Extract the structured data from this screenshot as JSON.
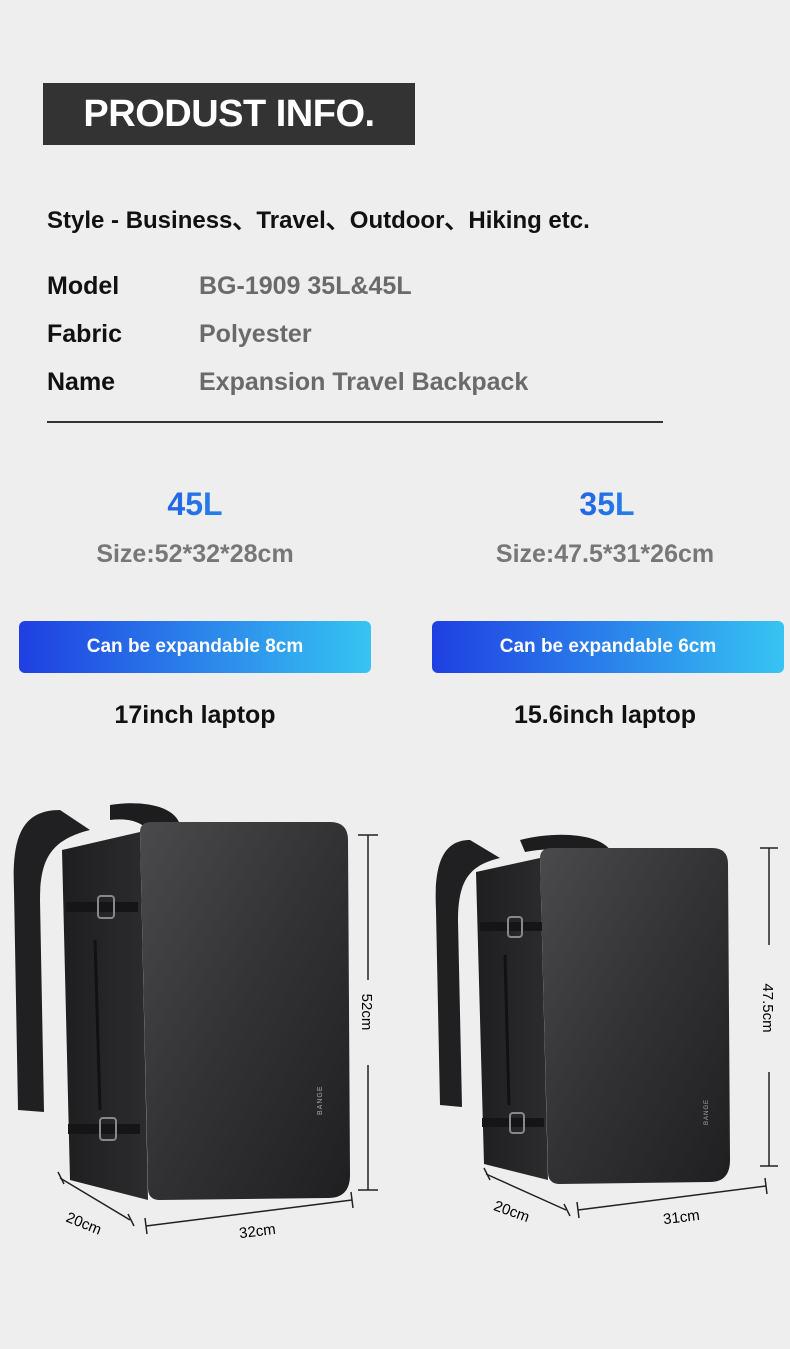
{
  "header": {
    "title": "PRODUST INFO."
  },
  "style_line": "Style - Business、Travel、Outdoor、Hiking etc.",
  "specs": [
    {
      "key": "Model",
      "value": "BG-1909 35L&45L"
    },
    {
      "key": "Fabric",
      "value": "Polyester"
    },
    {
      "key": "Name",
      "value": "Expansion Travel Backpack"
    }
  ],
  "variants": [
    {
      "capacity": "45L",
      "size": "Size:52*32*28cm",
      "expand": "Can be expandable 8cm",
      "laptop": "17inch laptop",
      "dims": {
        "height": "52cm",
        "depth": "20cm",
        "width": "32cm"
      }
    },
    {
      "capacity": "35L",
      "size": "Size:47.5*31*26cm",
      "expand": "Can be expandable 6cm",
      "laptop": "15.6inch laptop",
      "dims": {
        "height": "47.5cm",
        "depth": "20cm",
        "width": "31cm"
      }
    }
  ],
  "brand_mark": "BANGE",
  "colors": {
    "background": "#eeeeee",
    "banner": "#333333",
    "accent_gradient_start": "#1f3fe2",
    "accent_gradient_end": "#36c4f2",
    "backpack": "#2c2c2e"
  }
}
